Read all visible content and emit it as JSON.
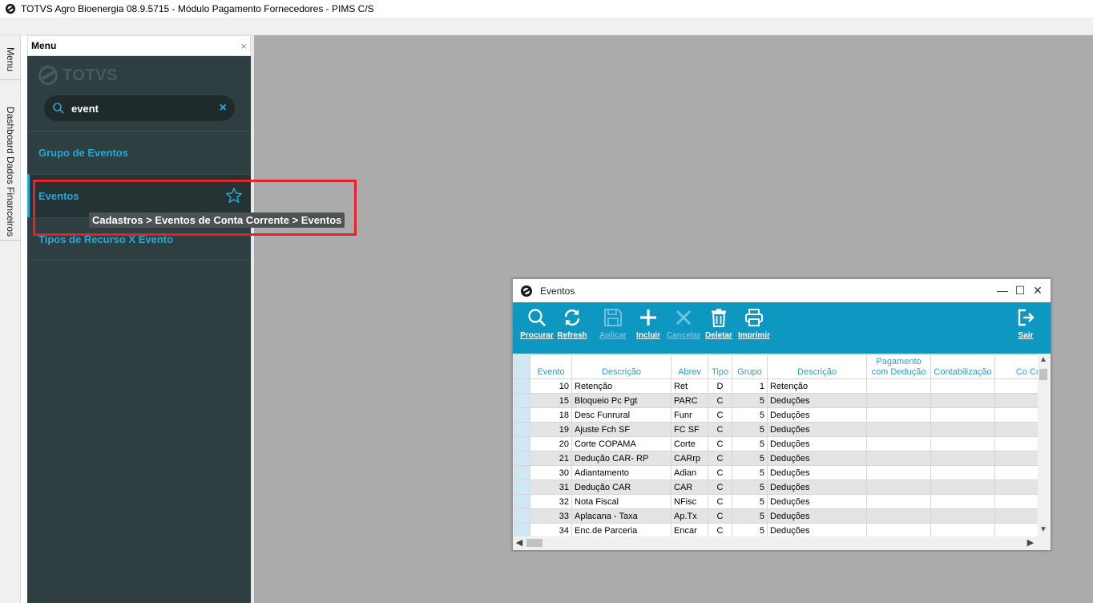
{
  "app": {
    "title": "TOTVS Agro Bioenergia 08.9.5715 - Módulo Pagamento Fornecedores - PIMS C/S"
  },
  "side_tabs": {
    "menu": "Menu",
    "dashboard": "Dashboard Dados Financeiros"
  },
  "menu": {
    "header": "Menu",
    "close": "×",
    "logo_text": "TOTVS",
    "search": {
      "value": "event",
      "clear": "×"
    },
    "items": [
      {
        "label": "Grupo de Eventos"
      },
      {
        "label": "Eventos"
      },
      {
        "label": "Tipos de Recurso X Evento"
      }
    ],
    "tooltip": "Cadastros > Eventos de Conta Corrente > Eventos",
    "accent_color": "#2aa7d3",
    "highlight_color": "#e3232a"
  },
  "window": {
    "title": "Eventos",
    "controls": {
      "minimize": "—",
      "maximize": "☐",
      "close": "✕"
    },
    "toolbar": {
      "procurar": "Procurar",
      "refresh": "Refresh",
      "aplicar": "Aplicar",
      "incluir": "Incluir",
      "cancelar": "Cancelar",
      "deletar": "Deletar",
      "imprimir": "Imprimir",
      "sair": "Sair"
    },
    "grid": {
      "headers": {
        "evento": "Evento",
        "descricao": "Descrição",
        "abrev": "Abrev",
        "tipo": "Tipo",
        "grupo": "Grupo",
        "descricao_grupo": "Descrição",
        "pagamento": "Pagamento com Dedução",
        "contabilizacao": "Contabilização",
        "partial": "Co Co"
      },
      "rows": [
        {
          "evento": "10",
          "descricao": "Retenção",
          "abrev": "Ret",
          "tipo": "D",
          "grupo": "1",
          "descricao_grupo": "Retenção"
        },
        {
          "evento": "15",
          "descricao": "Bloqueio Pc Pgt",
          "abrev": "PARC",
          "tipo": "C",
          "grupo": "5",
          "descricao_grupo": "Deduções"
        },
        {
          "evento": "18",
          "descricao": "Desc Funrural",
          "abrev": "Funr",
          "tipo": "C",
          "grupo": "5",
          "descricao_grupo": "Deduções"
        },
        {
          "evento": "19",
          "descricao": "Ajuste Fch SF",
          "abrev": "FC SF",
          "tipo": "C",
          "grupo": "5",
          "descricao_grupo": "Deduções"
        },
        {
          "evento": "20",
          "descricao": "Corte COPAMA",
          "abrev": "Corte",
          "tipo": "C",
          "grupo": "5",
          "descricao_grupo": "Deduções"
        },
        {
          "evento": "21",
          "descricao": "Dedução CAR- RP",
          "abrev": "CARrp",
          "tipo": "C",
          "grupo": "5",
          "descricao_grupo": "Deduções"
        },
        {
          "evento": "30",
          "descricao": "Adiantamento",
          "abrev": "Adian",
          "tipo": "C",
          "grupo": "5",
          "descricao_grupo": "Deduções"
        },
        {
          "evento": "31",
          "descricao": "Dedução CAR",
          "abrev": "CAR",
          "tipo": "C",
          "grupo": "5",
          "descricao_grupo": "Deduções"
        },
        {
          "evento": "32",
          "descricao": "Nota Fiscal",
          "abrev": "NFisc",
          "tipo": "C",
          "grupo": "5",
          "descricao_grupo": "Deduções"
        },
        {
          "evento": "33",
          "descricao": "Aplacana - Taxa",
          "abrev": "Ap.Tx",
          "tipo": "C",
          "grupo": "5",
          "descricao_grupo": "Deduções"
        },
        {
          "evento": "34",
          "descricao": "Enc.de Parceria",
          "abrev": "Encar",
          "tipo": "C",
          "grupo": "5",
          "descricao_grupo": "Deduções"
        }
      ]
    },
    "toolbar_color": "#0e97c1"
  }
}
